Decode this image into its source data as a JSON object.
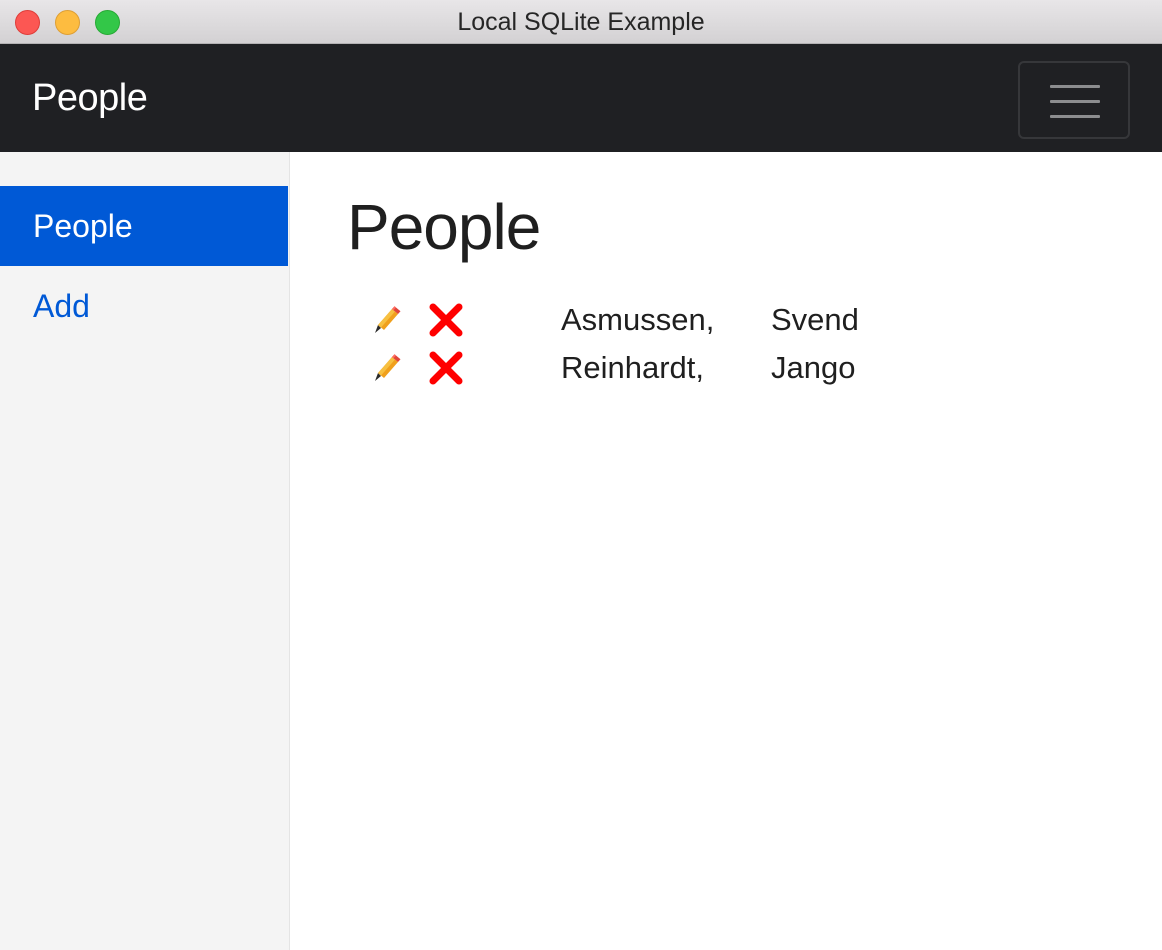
{
  "window": {
    "title": "Local SQLite Example"
  },
  "navbar": {
    "brand": "People",
    "toggler_icon": "hamburger-icon"
  },
  "sidebar": {
    "items": [
      {
        "label": "People",
        "active": true
      },
      {
        "label": "Add",
        "active": false
      }
    ]
  },
  "main": {
    "title": "People",
    "people": [
      {
        "last_name": "Asmussen,",
        "first_name": "Svend",
        "edit_icon": "pencil-icon",
        "delete_icon": "cross-icon"
      },
      {
        "last_name": "Reinhardt,",
        "first_name": "Jango",
        "edit_icon": "pencil-icon",
        "delete_icon": "cross-icon"
      }
    ]
  },
  "colors": {
    "navbar_bg": "#1f2023",
    "accent": "#0059d6",
    "sidebar_bg": "#f4f4f4",
    "delete_red": "#ff0000",
    "pencil_orange": "#f0a01c"
  }
}
